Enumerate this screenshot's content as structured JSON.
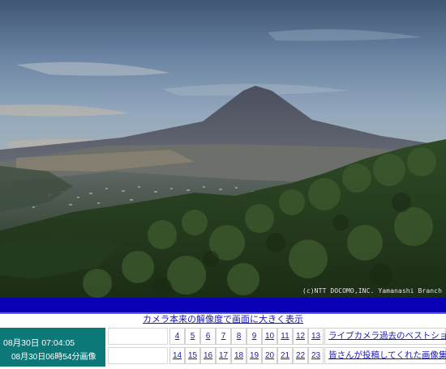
{
  "camera": {
    "credit": "(c)NTT DOCOMO,INC. Yamanashi Branch"
  },
  "large_view_link": "カメラ本来の解像度で画面に大きく表示",
  "time": {
    "current": "08月30日  07:04:05",
    "image": "08月30日06時54分画像"
  },
  "hour_links": {
    "row1": [
      "4",
      "5",
      "6",
      "7",
      "8",
      "9",
      "10",
      "11",
      "12",
      "13"
    ],
    "row2": [
      "14",
      "15",
      "16",
      "17",
      "18",
      "19",
      "20",
      "21",
      "22",
      "23"
    ]
  },
  "side_links": {
    "best_shot": "ライブカメラ過去のベストショット",
    "user_gallery": "皆さんが投稿してくれた画像集"
  },
  "colors": {
    "bar_blue": "#0b00b6",
    "time_box_teal": "#0c7877",
    "link_blue": "#1a19b7"
  }
}
